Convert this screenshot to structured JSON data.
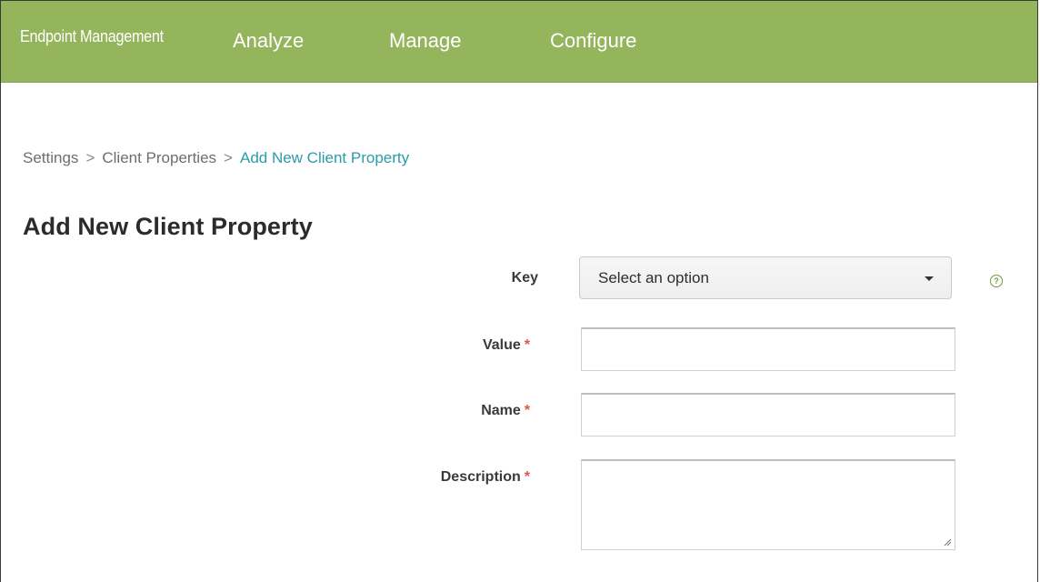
{
  "header": {
    "brand": "Endpoint Management",
    "nav": [
      {
        "label": "Analyze"
      },
      {
        "label": "Manage"
      },
      {
        "label": "Configure"
      }
    ],
    "background_color": "#94b55b"
  },
  "breadcrumb": {
    "items": [
      "Settings",
      "Client Properties"
    ],
    "current": "Add New Client Property",
    "separator": ">"
  },
  "page": {
    "title": "Add New Client Property"
  },
  "form": {
    "key": {
      "label": "Key",
      "selected": "Select an option",
      "help_icon": "question-circle-icon"
    },
    "value": {
      "label": "Value",
      "required": "*",
      "value": ""
    },
    "name": {
      "label": "Name",
      "required": "*",
      "value": ""
    },
    "description": {
      "label": "Description",
      "required": "*",
      "value": ""
    }
  },
  "colors": {
    "accent_link": "#2a9cab",
    "required": "#e5534b",
    "help_icon": "#6f9a3a"
  }
}
